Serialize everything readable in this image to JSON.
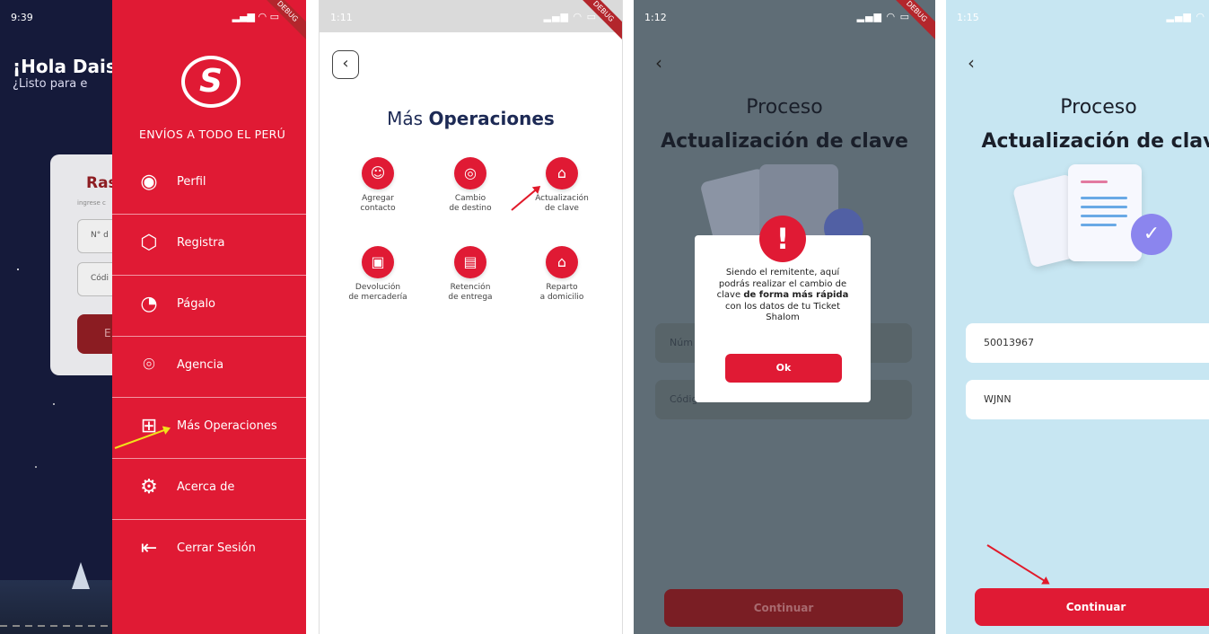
{
  "screen1": {
    "status_time": "9:39",
    "greeting": "¡Hola Dais",
    "subgreeting": "¿Listo para e",
    "card_title": "Ras",
    "card_hint": "ingrese c",
    "field_number_placeholder": "N° d",
    "field_code_placeholder": "Códi",
    "button_fragment": "E",
    "drawer": {
      "tagline": "ENVÍOS A TODO EL PERÚ",
      "items": [
        {
          "label": "Perfil",
          "icon": "user-icon"
        },
        {
          "label": "Registra",
          "icon": "box-icon"
        },
        {
          "label": "Págalo",
          "icon": "pay-icon"
        },
        {
          "label": "Agencia",
          "icon": "location-icon"
        },
        {
          "label": "Más Operaciones",
          "icon": "grid-plus-icon"
        },
        {
          "label": "Acerca de",
          "icon": "gear-icon"
        },
        {
          "label": "Cerrar Sesión",
          "icon": "logout-icon"
        }
      ]
    }
  },
  "screen2": {
    "status_time": "1:11",
    "title_light": "Más",
    "title_bold": "Operaciones",
    "ops": [
      {
        "line1": "Agregar",
        "line2": "contacto",
        "icon": "add-contact-icon"
      },
      {
        "line1": "Cambio",
        "line2": "de destino",
        "icon": "change-destination-icon"
      },
      {
        "line1": "Actualización",
        "line2": "de clave",
        "icon": "lock-icon"
      },
      {
        "line1": "Devolución",
        "line2": "de mercadería",
        "icon": "return-box-icon"
      },
      {
        "line1": "Retención",
        "line2": "de entrega",
        "icon": "hold-box-icon"
      },
      {
        "line1": "Reparto",
        "line2": "a domicilio",
        "icon": "home-icon"
      }
    ]
  },
  "screen3": {
    "status_time": "1:12",
    "title_line1": "Proceso",
    "title_line2": "Actualización de clave",
    "input1_placeholder": "Núm",
    "input2_placeholder": "Código de la orden",
    "dialog": {
      "msg_part1": "Siendo el remitente, aquí podrás realizar el cambio de clave",
      "msg_bold": "de forma más rápida",
      "msg_part2": "con los datos de tu Ticket Shalom",
      "ok_label": "Ok"
    },
    "continue_label": "Continuar"
  },
  "screen4": {
    "status_time": "1:15",
    "title_line1": "Proceso",
    "title_line2": "Actualización de clav",
    "input1_value": "50013967",
    "input2_value": "WJNN",
    "continue_label": "Continuar"
  },
  "debug_label": "DEBUG"
}
